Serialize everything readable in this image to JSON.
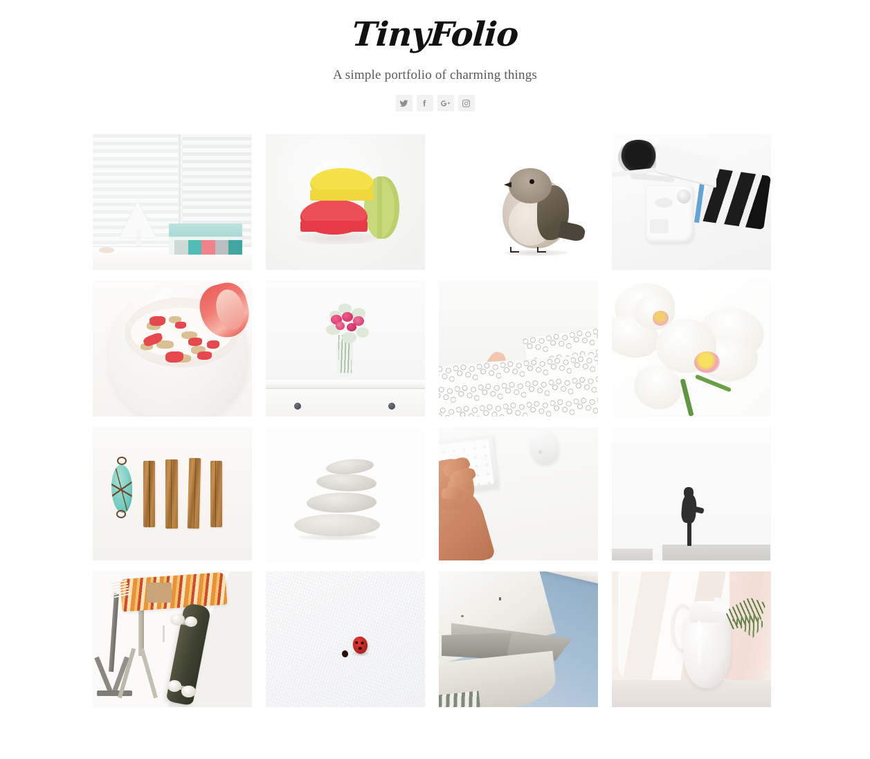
{
  "site": {
    "title": "TinyFolio",
    "tagline": "A simple portfolio of charming things"
  },
  "social": [
    {
      "name": "twitter",
      "label": "Twitter",
      "icon": "twitter-icon"
    },
    {
      "name": "facebook",
      "label": "Facebook",
      "icon": "facebook-icon"
    },
    {
      "name": "googleplus",
      "label": "Google+",
      "icon": "google-plus-icon"
    },
    {
      "name": "instagram",
      "label": "Instagram",
      "icon": "instagram-icon"
    }
  ],
  "colors": {
    "page_background": "#ffffff",
    "title_text": "#111111",
    "tagline_text": "#5a5a5a",
    "social_button_background": "#f2f2f2",
    "social_icon": "#8e8e8e"
  },
  "gallery": {
    "columns": 4,
    "rows": 4,
    "items": [
      {
        "position": 1,
        "alt": "White table lamp on a windowsill beside a teal patterned box, window blinds behind"
      },
      {
        "position": 2,
        "alt": "Three macarons stacked - yellow on coral red, with a green macaron leaning beside"
      },
      {
        "position": 3,
        "alt": "Small brown and grey fledgling bird standing on a white background"
      },
      {
        "position": 4,
        "alt": "White mirrorless camera with a white and black zoom lens, headphones behind"
      },
      {
        "position": 5,
        "alt": "White bowl of yogurt with oat granola and fresh sliced strawberries"
      },
      {
        "position": 6,
        "alt": "Glass vase of pink carnations and baby's breath on a white dresser with dark knobs"
      },
      {
        "position": 7,
        "alt": "An arm reaching out from under a squiggle patterned white duvet in bed"
      },
      {
        "position": 8,
        "alt": "Two white phalaenopsis orchid blooms with pink and yellow centers on a green stem"
      },
      {
        "position": 9,
        "alt": "Turquoise wire-wrapped stone pendant beside four cinnamon sticks in a row"
      },
      {
        "position": 10,
        "alt": "Stack of four smooth grey zen balancing stones on white"
      },
      {
        "position": 11,
        "alt": "Hand resting on a white keyboard next to a white mouse on a white desk"
      },
      {
        "position": 12,
        "alt": "Silhouette of a person standing on a concrete ledge against a bright white sky"
      },
      {
        "position": 13,
        "alt": "Skateboard leaning against a wall next to a stand draped with an orange patterned blanket"
      },
      {
        "position": 14,
        "alt": "A single red ladybug on a white textured surface"
      },
      {
        "position": 15,
        "alt": "Angular white concrete architecture against a blue sky seen from below"
      },
      {
        "position": 16,
        "alt": "White ceramic pitcher with a fern sprig in front of a sheer curtain"
      }
    ]
  }
}
